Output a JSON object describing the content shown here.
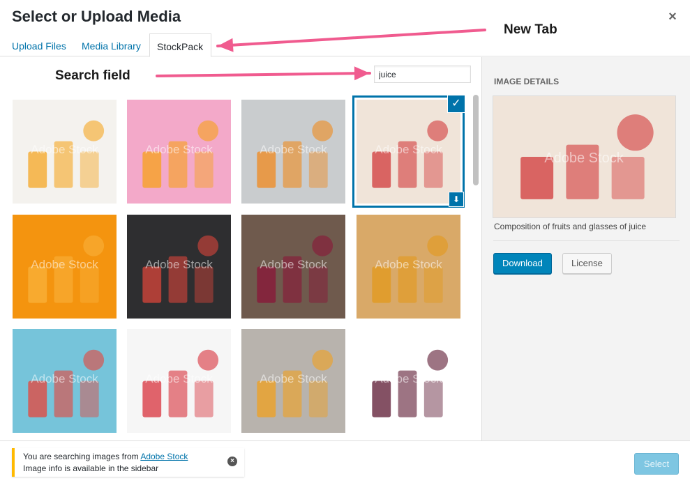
{
  "modal": {
    "title": "Select or Upload Media",
    "close_glyph": "×"
  },
  "tabs": [
    {
      "label": "Upload Files",
      "active": false
    },
    {
      "label": "Media Library",
      "active": false
    },
    {
      "label": "StockPack",
      "active": true
    }
  ],
  "annotations": {
    "new_tab": "New Tab",
    "search_field": "Search field",
    "arrow_color": "#f05b8f"
  },
  "search": {
    "value": "juice",
    "placeholder": ""
  },
  "grid": {
    "watermark": "Adobe Stock",
    "items": [
      {
        "subject": "glass of orange juice",
        "selected": false,
        "bg": "#f4f2ee",
        "accent": "#f5a623"
      },
      {
        "subject": "orange slices on pink",
        "selected": false,
        "bg": "#f3a9c9",
        "accent": "#f7a21b"
      },
      {
        "subject": "oranges on wooden boards",
        "selected": false,
        "bg": "#c9ccce",
        "accent": "#f08a1e"
      },
      {
        "subject": "fruits and glasses of juice",
        "selected": true,
        "bg": "#f0e4d9",
        "accent": "#d23a3a"
      },
      {
        "subject": "orange splash",
        "selected": false,
        "bg": "#f4940f",
        "accent": "#f9b13b"
      },
      {
        "subject": "fruit juices on dark background",
        "selected": false,
        "bg": "#2e2e30",
        "accent": "#d9453a"
      },
      {
        "subject": "beet juice",
        "selected": false,
        "bg": "#6f5a4d",
        "accent": "#8a1538"
      },
      {
        "subject": "vegetable juices",
        "selected": false,
        "bg": "#d9a968",
        "accent": "#e29a1c"
      },
      {
        "subject": "juices on blue wood",
        "selected": false,
        "bg": "#76c4da",
        "accent": "#e8443a"
      },
      {
        "subject": "pouring juices",
        "selected": false,
        "bg": "#f6f6f6",
        "accent": "#d8323c"
      },
      {
        "subject": "citrus drinks on tray",
        "selected": false,
        "bg": "#b8b3ad",
        "accent": "#f0a01f"
      },
      {
        "subject": "beet juice and lemons",
        "selected": false,
        "bg": "#ffffff",
        "accent": "#5b1730"
      }
    ]
  },
  "details": {
    "heading": "IMAGE DETAILS",
    "caption": "Composition of fruits and glasses of juice",
    "download_label": "Download",
    "license_label": "License"
  },
  "notice": {
    "line1_prefix": "You are searching images from ",
    "line1_link": "Adobe Stock",
    "line2": "Image info is available in the sidebar",
    "dismiss_glyph": "×"
  },
  "toolbar": {
    "select_label": "Select"
  }
}
